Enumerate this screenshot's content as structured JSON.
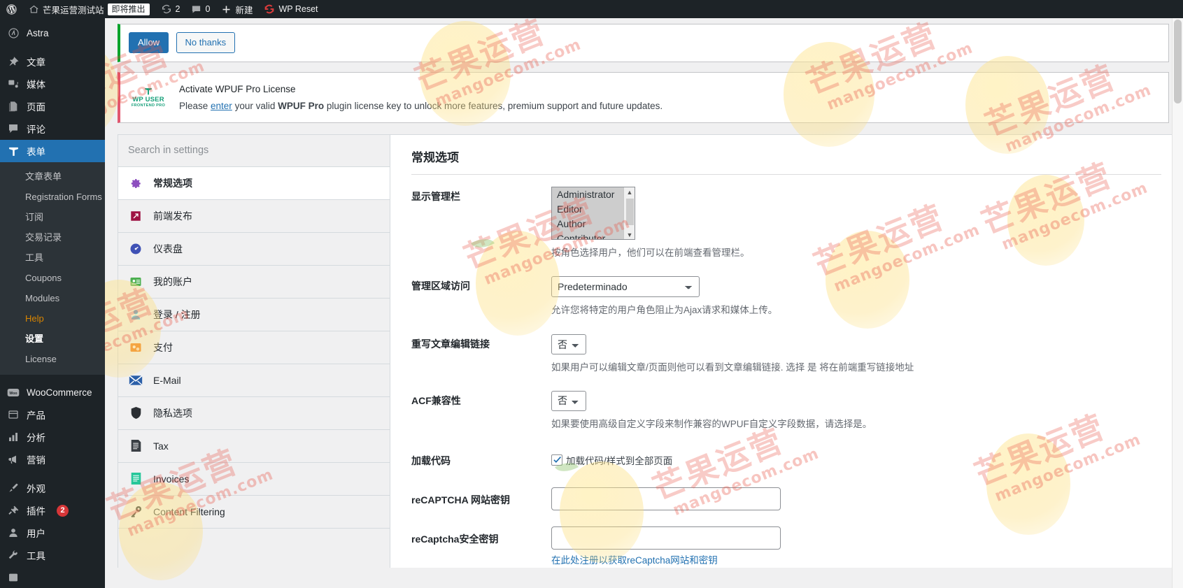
{
  "adminbar": {
    "wp_logo": "wordpress-icon",
    "site_name": "芒果运营测试站",
    "coming_soon": "即将推出",
    "updates_icon": "updates-icon",
    "updates_count": "2",
    "comments_icon": "comment-icon",
    "comments_count": "0",
    "new_label": "新建",
    "wp_reset": "WP Reset"
  },
  "adminmenu": {
    "astra": "Astra",
    "items": [
      {
        "label": "文章",
        "icon": "pin-icon"
      },
      {
        "label": "媒体",
        "icon": "media-icon"
      },
      {
        "label": "页面",
        "icon": "page-icon"
      },
      {
        "label": "评论",
        "icon": "comment-icon"
      },
      {
        "label": "表单",
        "icon": "forms-icon",
        "current": true
      }
    ],
    "submenu": [
      {
        "label": "文章表单"
      },
      {
        "label": "Registration Forms"
      },
      {
        "label": "订阅"
      },
      {
        "label": "交易记录"
      },
      {
        "label": "工具"
      },
      {
        "label": "Coupons"
      },
      {
        "label": "Modules"
      },
      {
        "label": "Help",
        "style": "help"
      },
      {
        "label": "设置",
        "style": "cur"
      },
      {
        "label": "License"
      }
    ],
    "items2": [
      {
        "label": "WooCommerce",
        "icon": "woo-icon"
      },
      {
        "label": "产品",
        "icon": "product-icon"
      },
      {
        "label": "分析",
        "icon": "chart-icon"
      },
      {
        "label": "营销",
        "icon": "megaphone-icon"
      }
    ],
    "items3": [
      {
        "label": "外观",
        "icon": "brush-icon"
      },
      {
        "label": "插件",
        "icon": "plug-icon",
        "badge": "2"
      },
      {
        "label": "用户",
        "icon": "user-icon"
      },
      {
        "label": "工具",
        "icon": "wrench-icon"
      }
    ]
  },
  "notices": {
    "allow": "Allow",
    "no_thanks": "No thanks",
    "license_title": "Activate WPUF Pro License",
    "license_desc_1": "Please ",
    "license_link": "enter",
    "license_desc_2": " your valid ",
    "license_bold": "WPUF Pro",
    "license_desc_3": " plugin license key to unlock more features, premium support and future updates.",
    "logo_top": "WP USER",
    "logo_bottom": "FRONTEND PRO"
  },
  "settings_nav": {
    "search_placeholder": "Search in settings",
    "items": [
      {
        "label": "常规选项",
        "icon": "gear-icon",
        "active": true
      },
      {
        "label": "前端发布",
        "icon": "edit-icon"
      },
      {
        "label": "仪表盘",
        "icon": "dashboard-icon"
      },
      {
        "label": "我的账户",
        "icon": "account-card-icon"
      },
      {
        "label": "登录 / 注册",
        "icon": "login-user-icon"
      },
      {
        "label": "支付",
        "icon": "payment-icon"
      },
      {
        "label": "E-Mail",
        "icon": "envelope-icon"
      },
      {
        "label": "隐私选项",
        "icon": "shield-icon"
      },
      {
        "label": "Tax",
        "icon": "document-icon"
      },
      {
        "label": "Invoices",
        "icon": "invoice-icon"
      },
      {
        "label": "Content Filtering",
        "icon": "key-icon"
      }
    ]
  },
  "settings_body": {
    "title": "常规选项",
    "fields": [
      {
        "label": "显示管理栏",
        "type": "multiselect",
        "options": [
          "Administrator",
          "Editor",
          "Author",
          "Contributor"
        ],
        "desc": "按角色选择用户，他们可以在前端查看管理栏。"
      },
      {
        "label": "管理区域访问",
        "type": "select",
        "value": "Predeterminado",
        "desc": "允许您将特定的用户角色阻止为Ajax请求和媒体上传。"
      },
      {
        "label": "重写文章编辑链接",
        "type": "select-narrow",
        "value": "否",
        "desc": "如果用户可以编辑文章/页面则他可以看到文章编辑链接. 选择 是 将在前端重写链接地址"
      },
      {
        "label": "ACF兼容性",
        "type": "select-narrow",
        "value": "否",
        "desc": "如果要使用高级自定义字段来制作兼容的WPUF自定义字段数据，请选择是。"
      },
      {
        "label": "加载代码",
        "type": "checkbox",
        "checked": true,
        "checkbox_label": "加载代码/样式到全部页面"
      },
      {
        "label": "reCAPTCHA 网站密钥",
        "type": "text",
        "value": ""
      },
      {
        "label": "reCaptcha安全密钥",
        "type": "text",
        "value": "",
        "desc": "在此处注册以获取reCaptcha网站和密钥",
        "desc_link": true
      }
    ]
  },
  "colors": {
    "accent": "#2271b1",
    "menu_bg": "#1d2327",
    "submenu_bg": "#2c3338",
    "notice_green": "#00a32a",
    "notice_red": "#e2566f",
    "badge_red": "#d63638",
    "help_orange": "#d98500"
  },
  "watermark": {
    "cn": "芒果运营",
    "en": "mangoecom.com"
  }
}
